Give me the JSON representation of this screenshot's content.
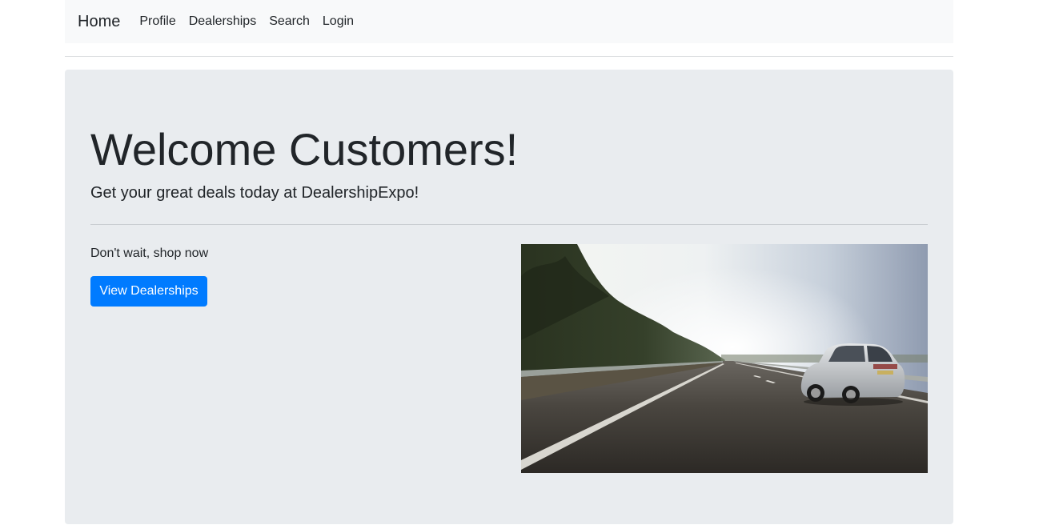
{
  "nav": {
    "brand": "Home",
    "links": [
      "Profile",
      "Dealerships",
      "Search",
      "Login"
    ]
  },
  "hero": {
    "title": "Welcome Customers!",
    "lead": "Get your great deals today at DealershipExpo!",
    "text": "Don't wait, shop now",
    "button_label": "View Dealerships"
  },
  "colors": {
    "primary": "#007bff",
    "jumbotron_bg": "#e9ecef",
    "navbar_bg": "#f8f9fa"
  }
}
